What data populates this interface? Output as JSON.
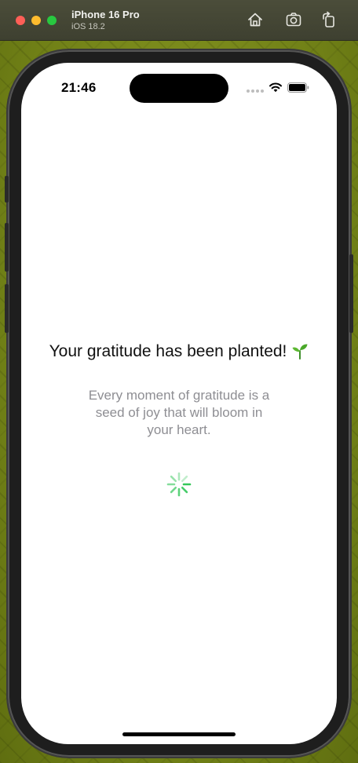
{
  "window": {
    "device_name": "iPhone 16 Pro",
    "os_version": "iOS 18.2",
    "toolbar_icons": [
      "home-icon",
      "screenshot-icon",
      "rotate-icon"
    ]
  },
  "status_bar": {
    "time": "21:46",
    "icons": [
      "signal-dots-icon",
      "wifi-icon",
      "battery-icon"
    ]
  },
  "content": {
    "headline": "Your gratitude has been planted!",
    "headline_icon": "sprout-icon",
    "subtext": "Every moment of gratitude is a seed of joy that will bloom in your heart.",
    "loading_indicator": "activity-spinner"
  },
  "colors": {
    "accent_green": "#34c759",
    "subtext_gray": "#8e8e93"
  }
}
